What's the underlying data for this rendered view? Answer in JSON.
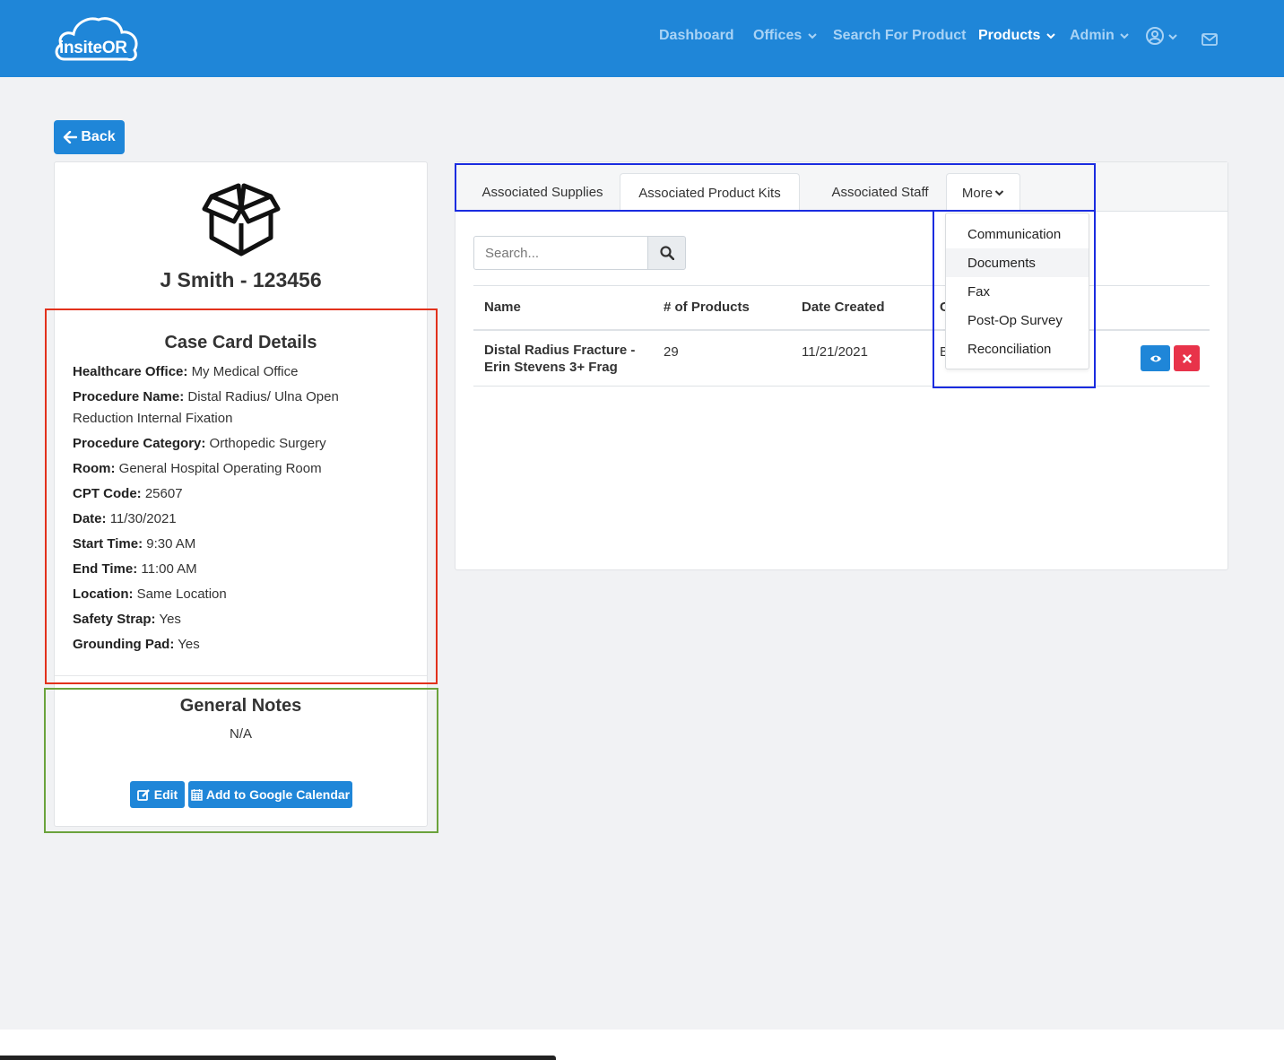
{
  "brand": {
    "logo_text": "insiteOR"
  },
  "nav": {
    "dashboard": "Dashboard",
    "offices": "Offices",
    "search_for_product": "Search For Product",
    "products": "Products",
    "admin": "Admin"
  },
  "back_label": "Back",
  "case_card": {
    "title": "J Smith - 123456",
    "details_heading": "Case Card Details",
    "details": [
      {
        "label": "Healthcare Office:",
        "value": "My Medical Office"
      },
      {
        "label": "Procedure Name:",
        "value": "Distal Radius/ Ulna Open Reduction Internal Fixation"
      },
      {
        "label": "Procedure Category:",
        "value": "Orthopedic Surgery"
      },
      {
        "label": "Room:",
        "value": "General Hospital Operating Room"
      },
      {
        "label": "CPT Code:",
        "value": "25607"
      },
      {
        "label": "Date:",
        "value": "11/30/2021"
      },
      {
        "label": "Start Time:",
        "value": "9:30 AM"
      },
      {
        "label": "End Time:",
        "value": "11:00 AM"
      },
      {
        "label": "Location:",
        "value": "Same Location"
      },
      {
        "label": "Safety Strap:",
        "value": "Yes"
      },
      {
        "label": "Grounding Pad:",
        "value": "Yes"
      }
    ],
    "notes_heading": "General Notes",
    "notes_value": "N/A",
    "edit_label": "Edit",
    "calendar_label": "Add to Google Calendar"
  },
  "tabs": {
    "supplies": "Associated Supplies",
    "product_kits": "Associated Product Kits",
    "staff": "Associated Staff",
    "more": "More"
  },
  "search": {
    "placeholder": "Search..."
  },
  "table": {
    "headers": [
      "Name",
      "# of Products",
      "Date Created",
      "C"
    ],
    "rows": [
      {
        "name": "Distal Radius Fracture - Erin Stevens 3+ Frag",
        "products": "29",
        "date": "11/21/2021",
        "created_by": "B"
      }
    ]
  },
  "more_menu": [
    "Communication",
    "Documents",
    "Fax",
    "Post-Op Survey",
    "Reconciliation"
  ],
  "colors": {
    "primary": "#1f86d8",
    "danger": "#e8334a",
    "background": "#f1f2f4"
  }
}
